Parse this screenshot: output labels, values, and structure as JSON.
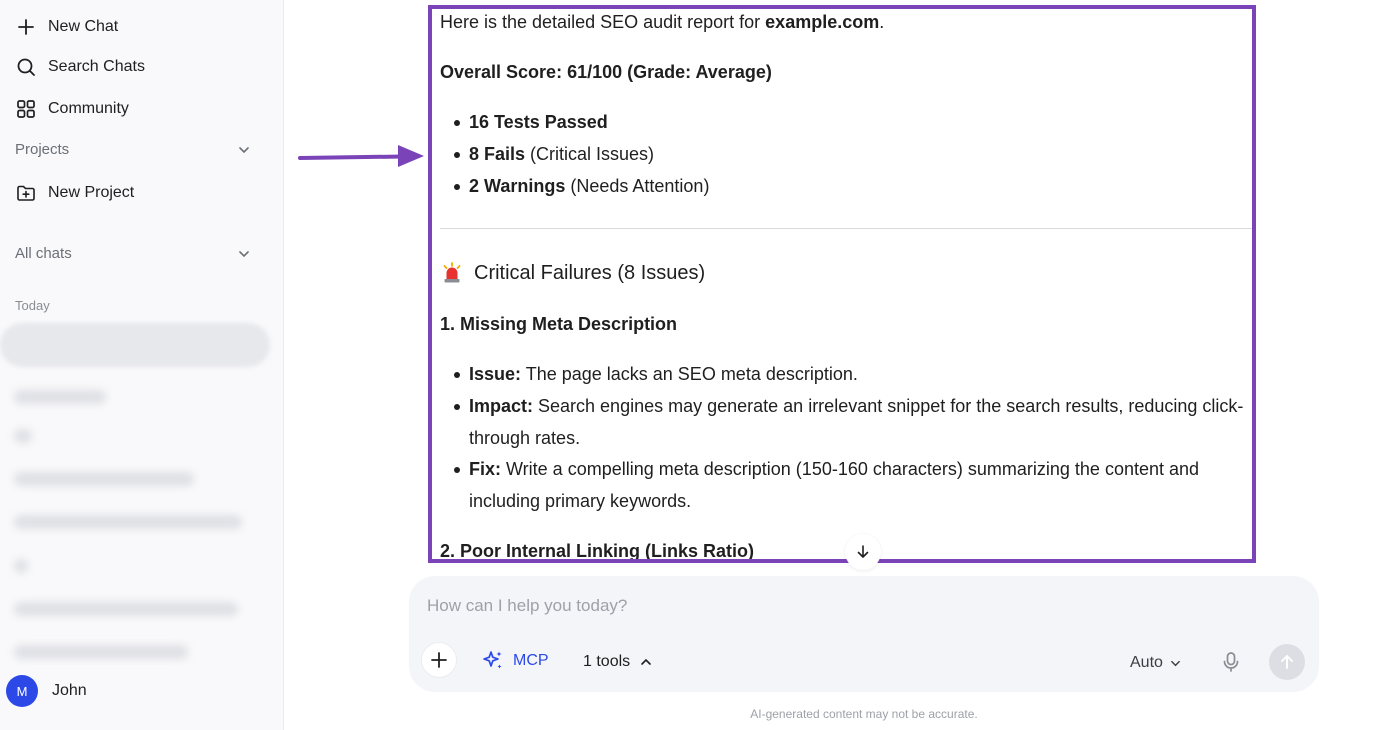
{
  "sidebar": {
    "new_chat": "New Chat",
    "search_chats": "Search Chats",
    "community": "Community",
    "projects_label": "Projects",
    "new_project": "New Project",
    "all_chats_label": "All chats",
    "today_label": "Today",
    "user": {
      "initial": "M",
      "name": "John"
    }
  },
  "message": {
    "intro_prefix": "Here is the detailed SEO audit report for ",
    "intro_domain": "example.com",
    "intro_suffix": ".",
    "overall_score": "Overall Score: 61/100 (Grade: Average)",
    "summary": [
      {
        "bold": "16 Tests Passed",
        "rest": ""
      },
      {
        "bold": "8 Fails",
        "rest": " (Critical Issues)"
      },
      {
        "bold": "2 Warnings",
        "rest": " (Needs Attention)"
      }
    ],
    "critical_heading": "Critical Failures (8 Issues)",
    "issue1_title": "1. Missing Meta Description",
    "issue1_items": [
      {
        "bold": "Issue:",
        "rest": " The page lacks an SEO meta description."
      },
      {
        "bold": "Impact:",
        "rest": " Search engines may generate an irrelevant snippet for the search results, reducing click-",
        "cont": "through rates."
      },
      {
        "bold": "Fix:",
        "rest": " Write a compelling meta description (150-160 characters) summarizing the content and",
        "cont": "including primary keywords."
      }
    ],
    "issue2_title": "2. Poor Internal Linking (Links Ratio)"
  },
  "composer": {
    "placeholder": "How can I help you today?",
    "mcp_label": "MCP",
    "tools_label": "1 tools",
    "mode_label": "Auto"
  },
  "disclaimer": "AI-generated content may not be accurate.",
  "colors": {
    "accent": "#2c49e8",
    "annotation": "#7a44b8",
    "sidebar_bg": "#f9f9fb"
  }
}
